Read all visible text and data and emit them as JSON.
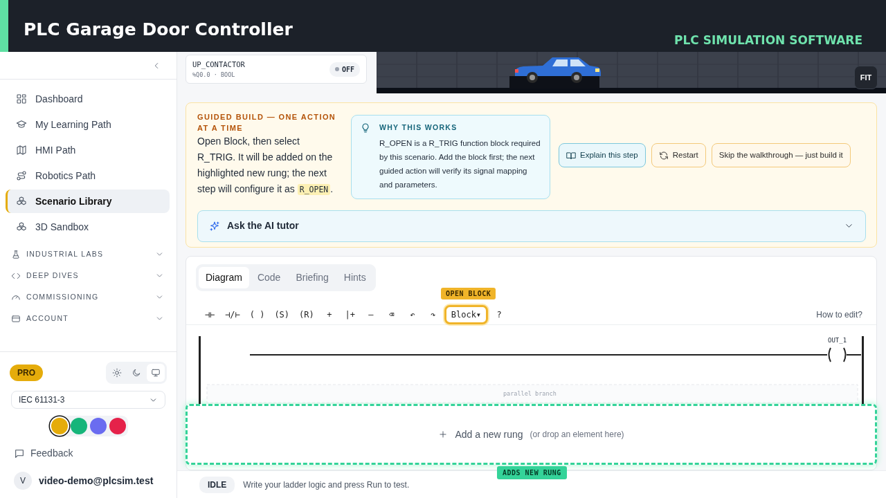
{
  "overlay": {
    "title": "PLC Garage Door Controller",
    "subtitle": "PLC SIMULATION SOFTWARE"
  },
  "sidebar": {
    "items": [
      {
        "label": "Dashboard",
        "selected": false
      },
      {
        "label": "My Learning Path",
        "selected": false
      },
      {
        "label": "HMI Path",
        "selected": false
      },
      {
        "label": "Robotics Path",
        "selected": false
      },
      {
        "label": "Scenario Library",
        "selected": true
      },
      {
        "label": "3D Sandbox",
        "selected": false
      }
    ],
    "groups": [
      {
        "label": "INDUSTRIAL LABS",
        "expanded": false
      },
      {
        "label": "DEEP DIVES",
        "expanded": false
      },
      {
        "label": "COMMISSIONING",
        "expanded": false
      },
      {
        "label": "ACCOUNT",
        "expanded": false
      }
    ],
    "plan_badge": "PRO",
    "theme_modes": [
      {
        "selected": false
      },
      {
        "selected": false
      },
      {
        "selected": true
      }
    ],
    "standard": "IEC 61131-3",
    "accent_colors": [
      {
        "color": "#e5ac0b",
        "selected": true
      },
      {
        "color": "#16b57a",
        "selected": false
      },
      {
        "color": "#6a6cf0",
        "selected": false
      },
      {
        "color": "#e5224a",
        "selected": false
      }
    ],
    "feedback": "Feedback",
    "user": {
      "initial": "V",
      "email": "video-demo@plcsim.test"
    }
  },
  "io_panel": {
    "signals": [
      {
        "name": "UP_CONTACTOR",
        "address": "%Q0.0 · BOOL",
        "on": false,
        "state": "OFF"
      }
    ]
  },
  "simulation": {
    "zoom_buttons": [
      "FIT"
    ]
  },
  "guided": {
    "heading": "GUIDED BUILD — ONE ACTION AT A TIME",
    "instruction": "Open Block, then select R_TRIG. It will be added on the highlighted new rung; the next step will configure it as",
    "instruction_code": "R_OPEN",
    "instruction_end": ".",
    "why_title": "WHY THIS WORKS",
    "why_text": "R_OPEN is a R_TRIG function block required by this scenario. Add the block first; the next guided action will verify its signal mapping and parameters.",
    "buttons": [
      {
        "label": "Explain this step",
        "kind": "info"
      },
      {
        "label": "Restart",
        "kind": "warn"
      },
      {
        "label": "Skip the walkthrough — just build it",
        "kind": "plain"
      }
    ],
    "tutor": {
      "label": "Ask the AI tutor",
      "expanded": false
    }
  },
  "editor": {
    "tabs": [
      {
        "label": "Diagram",
        "selected": true
      },
      {
        "label": "Code",
        "selected": false
      },
      {
        "label": "Briefing",
        "selected": false
      },
      {
        "label": "Hints",
        "selected": false
      }
    ],
    "toolbar": [
      {
        "label": "⊣⊢",
        "highlighted": false
      },
      {
        "label": "⊣/⊢",
        "highlighted": false
      },
      {
        "label": "( )",
        "highlighted": false
      },
      {
        "label": "(S)",
        "highlighted": false
      },
      {
        "label": "(R)",
        "highlighted": false
      },
      {
        "label": "+",
        "highlighted": false
      },
      {
        "label": "|+",
        "highlighted": false
      },
      {
        "label": "–",
        "highlighted": false
      },
      {
        "label": "⌫",
        "highlighted": false
      },
      {
        "label": "↶",
        "highlighted": false
      },
      {
        "label": "↷",
        "highlighted": false
      },
      {
        "label": "Block▾",
        "highlighted": true
      },
      {
        "label": "?",
        "highlighted": false
      }
    ],
    "callout": "OPEN BLOCK",
    "help_link": "How to edit?",
    "coil_label": "OUT_1",
    "branch_label": "parallel branch",
    "add_rung": {
      "label": "Add a new rung",
      "note": "(or drop an element here)",
      "highlighted": true,
      "tag": "ADDS NEW RUNG"
    }
  },
  "status_bar": {
    "state": "IDLE",
    "message": "Write your ladder logic and press Run to test."
  }
}
